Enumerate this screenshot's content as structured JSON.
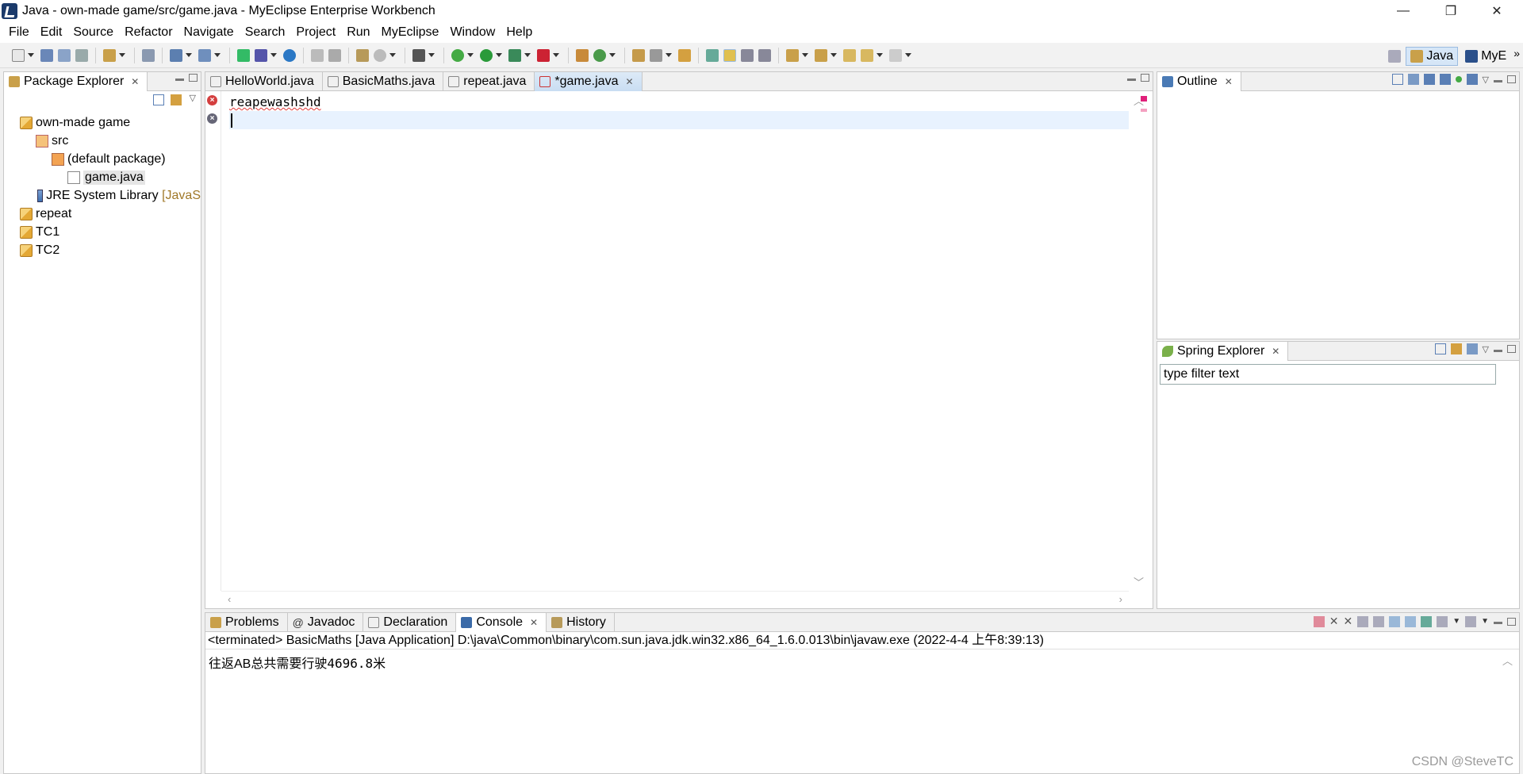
{
  "window": {
    "title": "Java - own-made game/src/game.java - MyEclipse Enterprise Workbench",
    "minimize": "—",
    "restore": "❐",
    "close": "✕"
  },
  "menu": [
    "File",
    "Edit",
    "Source",
    "Refactor",
    "Navigate",
    "Search",
    "Project",
    "Run",
    "MyEclipse",
    "Window",
    "Help"
  ],
  "perspectives": {
    "java": "Java",
    "myeclipse": "MyE",
    "more": "»"
  },
  "package_explorer": {
    "tab": "Package Explorer",
    "tree": [
      {
        "label": "own-made game",
        "level": 0,
        "icon": "project-open-icon"
      },
      {
        "label": "src",
        "level": 1,
        "icon": "source-folder-icon"
      },
      {
        "label": "(default package)",
        "level": 2,
        "icon": "package-icon"
      },
      {
        "label": "game.java",
        "level": 3,
        "icon": "java-file-icon",
        "selected": true
      },
      {
        "label": "JRE System Library",
        "suffix": "[JavaS",
        "level": 1,
        "icon": "library-icon"
      },
      {
        "label": "repeat",
        "level": 0,
        "icon": "project-icon"
      },
      {
        "label": "TC1",
        "level": 0,
        "icon": "project-icon"
      },
      {
        "label": "TC2",
        "level": 0,
        "icon": "project-icon"
      }
    ]
  },
  "editor": {
    "tabs": [
      {
        "label": "HelloWorld.java",
        "active": false
      },
      {
        "label": "BasicMaths.java",
        "active": false
      },
      {
        "label": "repeat.java",
        "active": false
      },
      {
        "label": "*game.java",
        "active": true
      }
    ],
    "lines": [
      "reapewashshd",
      ""
    ]
  },
  "outline": {
    "tab": "Outline"
  },
  "spring_explorer": {
    "tab": "Spring Explorer",
    "filter_placeholder": "type filter text"
  },
  "bottom": {
    "tabs": [
      {
        "label": "Problems",
        "active": false
      },
      {
        "label": "Javadoc",
        "active": false
      },
      {
        "label": "Declaration",
        "active": false
      },
      {
        "label": "Console",
        "active": true
      },
      {
        "label": "History",
        "active": false
      }
    ],
    "terminated": "<terminated> BasicMaths [Java Application] D:\\java\\Common\\binary\\com.sun.java.jdk.win32.x86_64_1.6.0.013\\bin\\javaw.exe (2022-4-4 上午8:39:13)",
    "output_prefix": "往返AB总共需要行驶",
    "output_value": "4696.8",
    "output_suffix": "米"
  },
  "watermark": "CSDN @SteveTC"
}
